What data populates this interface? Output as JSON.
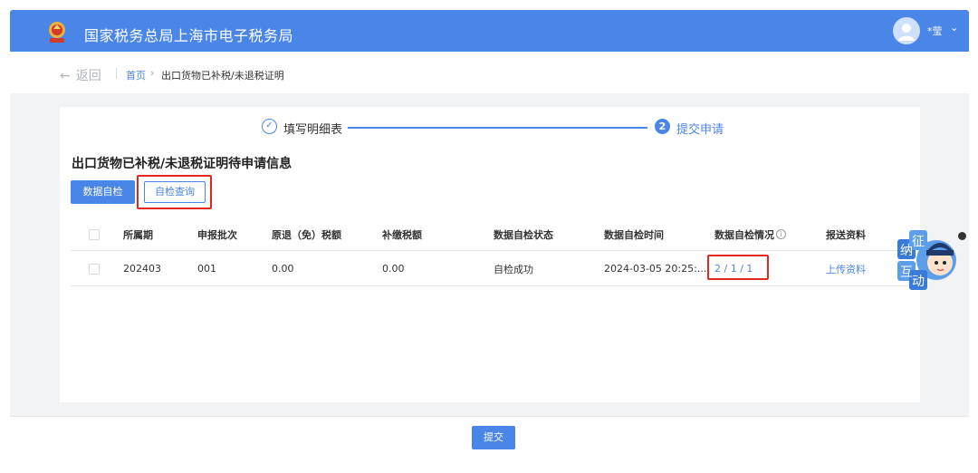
{
  "header": {
    "title": "国家税务总局上海市电子税务局",
    "user_name": "*莹",
    "caret": "⌄"
  },
  "nav": {
    "back_label": "返回",
    "breadcrumb_home": "首页",
    "breadcrumb_sep": "›",
    "breadcrumb_current": "出口货物已补税/未退税证明"
  },
  "steps": {
    "step1_label": "填写明细表",
    "step1_icon": "check-icon",
    "step2_number": "2",
    "step2_label": "提交申请"
  },
  "section": {
    "title": "出口货物已补税/未退税证明待申请信息"
  },
  "toolbar": {
    "check_label": "数据自检",
    "query_label": "自检查询"
  },
  "table": {
    "headers": [
      "所属期",
      "申报批次",
      "原退（免）税额",
      "补缴税额",
      "数据自检状态",
      "数据自检时间",
      "数据自检情况",
      "报送资料"
    ],
    "rows": [
      {
        "period": "202403",
        "batch": "001",
        "refund_amount": "0.00",
        "payback_amount": "0.00",
        "check_status": "自检成功",
        "check_time": "2024-03-05 20:25:...",
        "check_result": "2 / 1 / 1",
        "upload_label": "上传资料"
      }
    ]
  },
  "widget": {
    "chars": [
      "纳",
      "征",
      "互",
      "动"
    ]
  },
  "footer": {
    "submit_label": "提交"
  },
  "colors": {
    "primary": "#4a86e8",
    "highlight": "#e0281e"
  }
}
